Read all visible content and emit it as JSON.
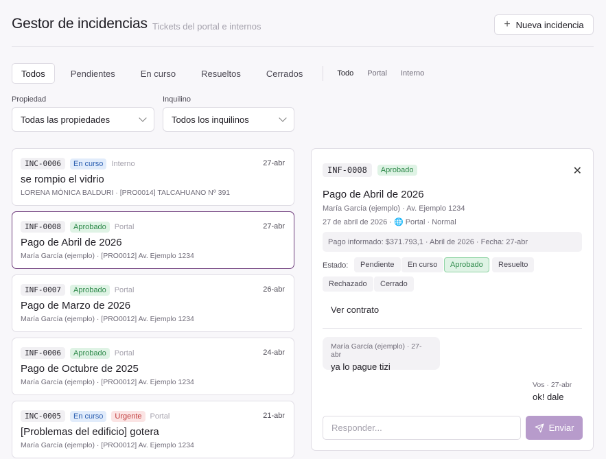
{
  "header": {
    "title": "Gestor de incidencias",
    "subtitle": "Tickets del portal e internos",
    "new_button": "Nueva incidencia"
  },
  "tabs": [
    {
      "label": "Todos",
      "active": true
    },
    {
      "label": "Pendientes",
      "active": false
    },
    {
      "label": "En curso",
      "active": false
    },
    {
      "label": "Resueltos",
      "active": false
    },
    {
      "label": "Cerrados",
      "active": false
    }
  ],
  "source_tabs": [
    {
      "label": "Todo",
      "active": true
    },
    {
      "label": "Portal",
      "active": false
    },
    {
      "label": "Interno",
      "active": false
    }
  ],
  "filters": {
    "property_label": "Propiedad",
    "property_value": "Todas las propiedades",
    "tenant_label": "Inquilino",
    "tenant_value": "Todos los inquilinos"
  },
  "tickets": [
    {
      "code": "INC-0006",
      "status": "En curso",
      "priority": "",
      "origin": "Interno",
      "date": "27-abr",
      "title": "se rompio el vidrio",
      "subtitle": "LORENA MÓNICA BALDURI · [PRO0014] TALCAHUANO Nº 391"
    },
    {
      "code": "INF-0008",
      "status": "Aprobado",
      "priority": "",
      "origin": "Portal",
      "date": "27-abr",
      "title": "Pago de Abril de 2026",
      "subtitle": "María García (ejemplo) · [PRO0012] Av. Ejemplo 1234"
    },
    {
      "code": "INF-0007",
      "status": "Aprobado",
      "priority": "",
      "origin": "Portal",
      "date": "26-abr",
      "title": "Pago de Marzo de 2026",
      "subtitle": "María García (ejemplo) · [PRO0012] Av. Ejemplo 1234"
    },
    {
      "code": "INF-0006",
      "status": "Aprobado",
      "priority": "",
      "origin": "Portal",
      "date": "24-abr",
      "title": "Pago de Octubre de 2025",
      "subtitle": "María García (ejemplo) · [PRO0012] Av. Ejemplo 1234"
    },
    {
      "code": "INC-0005",
      "status": "En curso",
      "priority": "Urgente",
      "origin": "Portal",
      "date": "21-abr",
      "title": "[Problemas del edificio] gotera",
      "subtitle": "María García (ejemplo) · [PRO0012] Av. Ejemplo 1234"
    }
  ],
  "detail": {
    "code": "INF-0008",
    "status": "Aprobado",
    "title": "Pago de Abril de 2026",
    "line1": "María García (ejemplo) · Av. Ejemplo 1234",
    "line2": "27 de abril de 2026 · 🌐 Portal · Normal",
    "info": "Pago informado: $371.793,1 · Abril de 2026 · Fecha: 27-abr",
    "estado_label": "Estado:",
    "states": [
      "Pendiente",
      "En curso",
      "Aprobado",
      "Resuelto",
      "Rechazado",
      "Cerrado"
    ],
    "active_state": "Aprobado",
    "contract_link": "Ver contrato",
    "messages": [
      {
        "meta": "María García (ejemplo) · 27-abr",
        "text": "ya lo pague tizi"
      },
      {
        "meta": "Vos · 27-abr",
        "text": "ok! dale"
      }
    ],
    "reply_placeholder": "Responder...",
    "send_label": "Enviar"
  },
  "colors": {
    "accent": "#6d3b7b",
    "send_button": "#b79bcb",
    "approved": "#2f8a4b",
    "in_progress": "#2c5fb0",
    "urgent": "#c03b3b"
  }
}
